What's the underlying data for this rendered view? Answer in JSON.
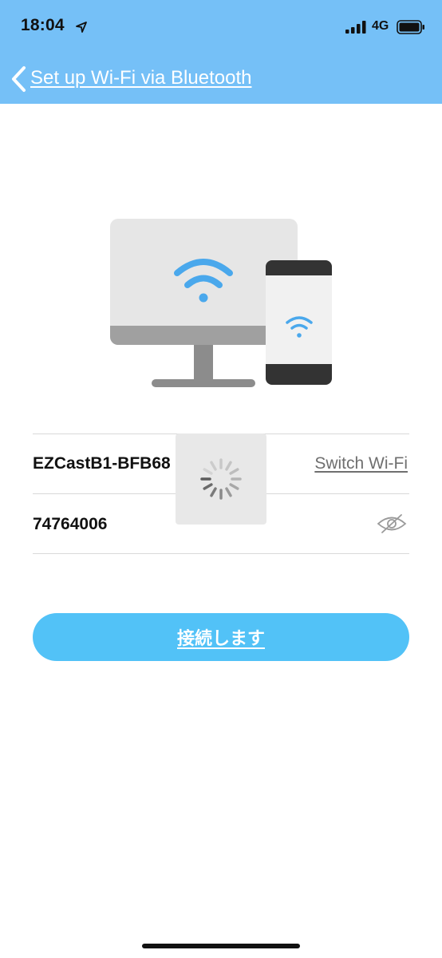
{
  "status_bar": {
    "time": "18:04",
    "network": "4G",
    "icons": [
      "location-arrow-icon",
      "cellular-signal-icon",
      "battery-icon"
    ]
  },
  "header": {
    "title": "Set up Wi-Fi via Bluetooth",
    "back_icon": "chevron-left-icon",
    "background_color": "#75c0f7"
  },
  "illustration": {
    "icons": [
      "monitor-icon",
      "phone-icon",
      "wifi-icon"
    ],
    "wifi_color": "#4aa8ec"
  },
  "form": {
    "ssid": "EZCastB1-BFB68",
    "switch_wifi_label": "Switch Wi-Fi",
    "password": "74764006",
    "password_visibility_icon": "eye-hidden-icon"
  },
  "loading_indicator": {
    "icon": "spinner-icon"
  },
  "connect_button": {
    "label": "接続します",
    "color": "#52c2f7"
  }
}
